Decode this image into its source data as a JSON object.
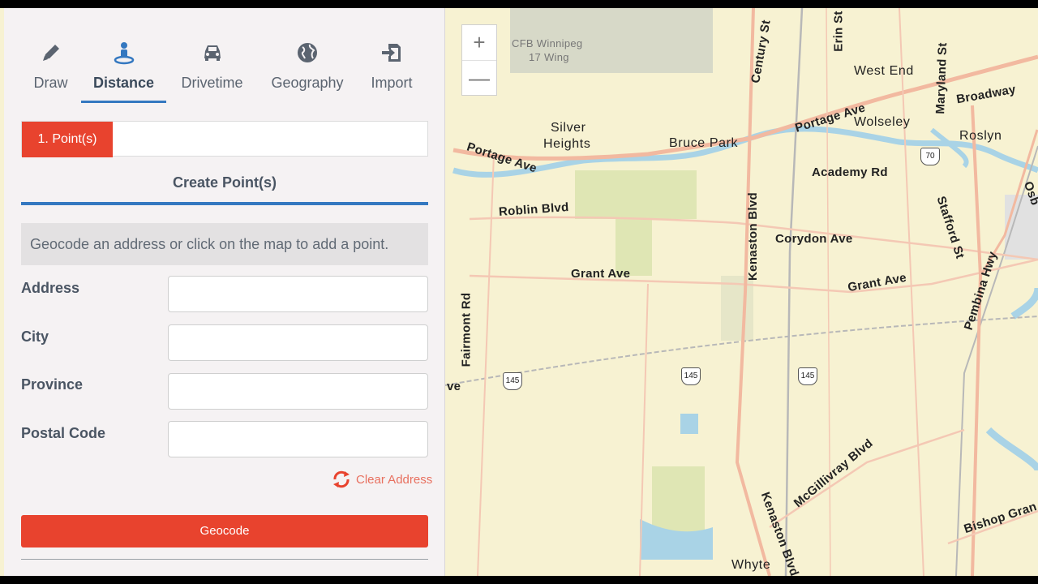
{
  "tabs": [
    {
      "label": "Draw",
      "icon": "pencil-icon"
    },
    {
      "label": "Distance",
      "icon": "person-pin-icon"
    },
    {
      "label": "Drivetime",
      "icon": "car-icon"
    },
    {
      "label": "Geography",
      "icon": "globe-icon"
    },
    {
      "label": "Import",
      "icon": "import-icon"
    }
  ],
  "active_tab": "Distance",
  "step": {
    "label": "1. Point(s)"
  },
  "section": {
    "title": "Create Point(s)"
  },
  "hint": "Geocode an address or click on the map to add a point.",
  "form": {
    "address_label": "Address",
    "city_label": "City",
    "province_label": "Province",
    "postal_label": "Postal Code",
    "address_value": "",
    "city_value": "",
    "province_value": "",
    "postal_value": ""
  },
  "clear_label": "Clear Address",
  "geocode_label": "Geocode",
  "map": {
    "zoom_in": "+",
    "zoom_out": "—",
    "labels": {
      "cfb": "CFB Winnipeg",
      "wing": "17 Wing",
      "west_end": "West End",
      "broadway": "Broadway",
      "wolseley": "Wolseley",
      "roslyn": "Roslyn",
      "silver": "Silver",
      "heights": "Heights",
      "bruce_park": "Bruce Park",
      "portage1": "Portage Ave",
      "portage2": "Portage Ave",
      "academy": "Academy Rd",
      "roblin": "Roblin Blvd",
      "corydon": "Corydon Ave",
      "grant1": "Grant Ave",
      "grant2": "Grant Ave",
      "kenaston1": "Kenaston Blvd",
      "kenaston2": "Kenaston Blvd",
      "fairmont": "Fairmont Rd",
      "century": "Century St",
      "erin": "Erin St",
      "maryland": "Maryland St",
      "stafford": "Stafford St",
      "pembina": "Pembina Hwy",
      "mcgillivray": "McGillivray Blvd",
      "bishop": "Bishop Gran",
      "whyte": "Whyte",
      "osb": "Osb",
      "ave_edge": "ve"
    },
    "shields": {
      "s1": "145",
      "s2": "145",
      "s3": "145",
      "s4": "70"
    },
    "colors": {
      "background": "#f7f2d2",
      "water": "#a9d3e6",
      "park": "#dfe6b4",
      "road": "#f2b9a0",
      "rail": "#b8b8b8"
    }
  },
  "colors": {
    "accent": "#e8432e",
    "tab_underline": "#3478c0"
  }
}
